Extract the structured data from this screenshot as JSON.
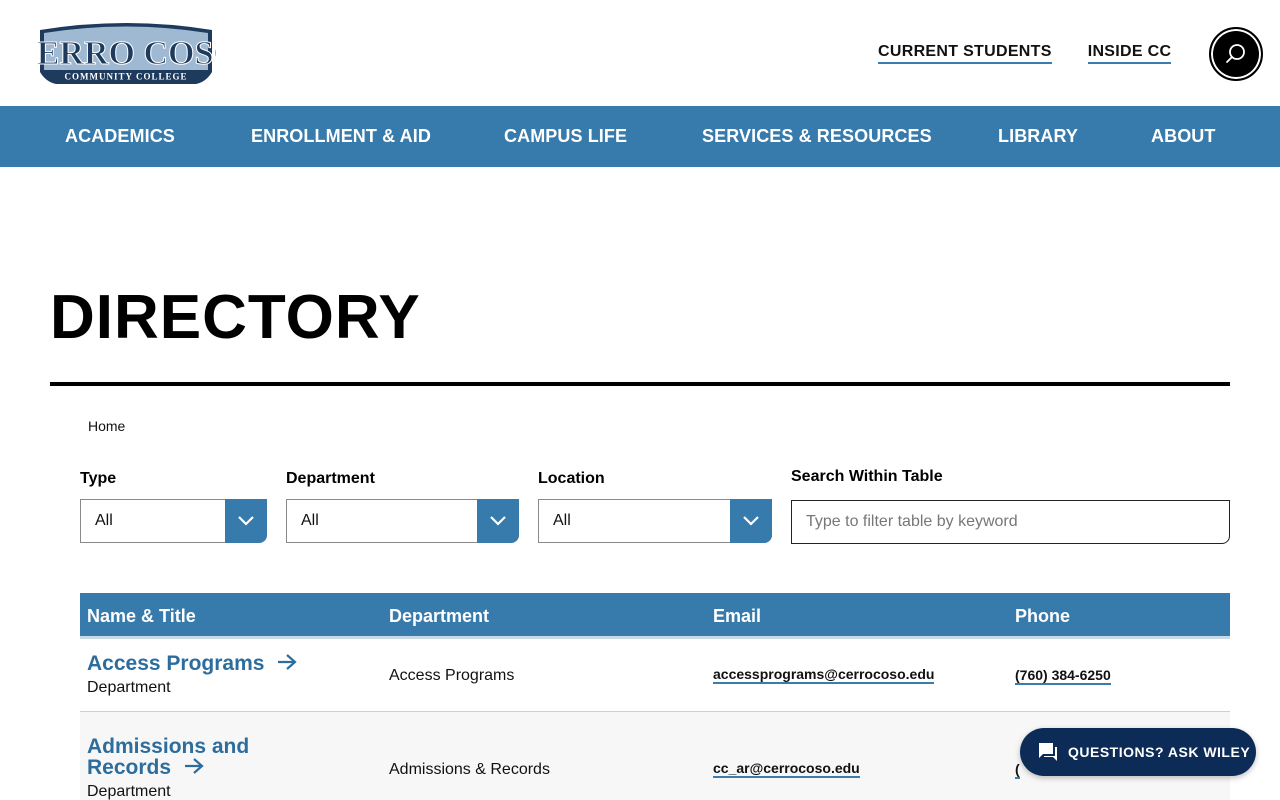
{
  "header": {
    "logo_main": "CERRO COSO",
    "logo_sub": "COMMUNITY COLLEGE",
    "top_links": [
      "CURRENT STUDENTS",
      "INSIDE CC"
    ],
    "search_icon": "search-icon"
  },
  "nav": {
    "items": [
      "ACADEMICS",
      "ENROLLMENT & AID",
      "CAMPUS LIFE",
      "SERVICES & RESOURCES",
      "LIBRARY",
      "ABOUT"
    ]
  },
  "page": {
    "title": "DIRECTORY",
    "breadcrumb": "Home"
  },
  "filters": {
    "type_label": "Type",
    "type_value": "All",
    "department_label": "Department",
    "department_value": "All",
    "location_label": "Location",
    "location_value": "All",
    "search_label": "Search Within Table",
    "search_placeholder": "Type to filter table by keyword"
  },
  "table": {
    "headers": [
      "Name & Title",
      "Department",
      "Email",
      "Phone"
    ],
    "rows": [
      {
        "name": "Access Programs",
        "title": "Department",
        "department": "Access Programs",
        "email": "accessprograms@cerrocoso.edu",
        "phone": "(760) 384-6250"
      },
      {
        "name_line1": "Admissions and",
        "name_line2": "Records",
        "title": "Department",
        "department": "Admissions & Records",
        "email": "cc_ar@cerrocoso.edu",
        "phone": "("
      }
    ]
  },
  "chat": {
    "label": "QUESTIONS? ASK WILEY",
    "icon": "chat-icon"
  },
  "colors": {
    "brand_blue": "#377aac",
    "link_blue": "#2d6d9d",
    "chat_navy": "#0d2b57"
  }
}
